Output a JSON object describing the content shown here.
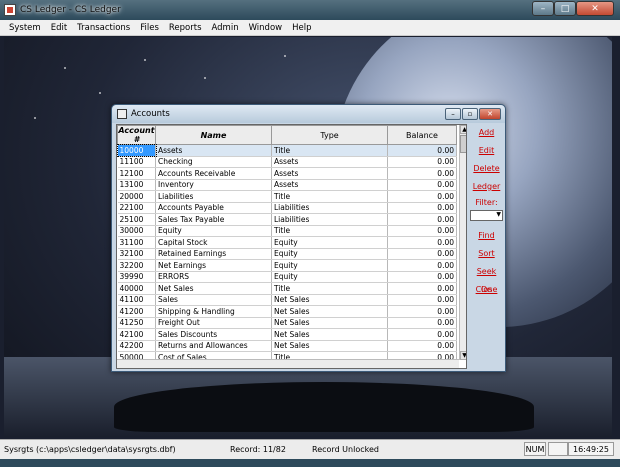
{
  "app": {
    "title": "CS Ledger - CS Ledger"
  },
  "menu": [
    "System",
    "Edit",
    "Transactions",
    "Files",
    "Reports",
    "Admin",
    "Window",
    "Help"
  ],
  "accounts_window": {
    "title": "Accounts",
    "columns": [
      "Account #",
      "Name",
      "Type",
      "Balance"
    ],
    "rows": [
      {
        "acct": "10000",
        "name": "Assets",
        "type": "Title",
        "balance": "0.00",
        "selected": true
      },
      {
        "acct": "11100",
        "name": "Checking",
        "type": "Assets",
        "balance": "0.00"
      },
      {
        "acct": "12100",
        "name": "Accounts Receivable",
        "type": "Assets",
        "balance": "0.00"
      },
      {
        "acct": "13100",
        "name": "Inventory",
        "type": "Assets",
        "balance": "0.00"
      },
      {
        "acct": "20000",
        "name": "Liabilities",
        "type": "Title",
        "balance": "0.00"
      },
      {
        "acct": "22100",
        "name": "Accounts Payable",
        "type": "Liabilities",
        "balance": "0.00"
      },
      {
        "acct": "25100",
        "name": "Sales Tax Payable",
        "type": "Liabilities",
        "balance": "0.00"
      },
      {
        "acct": "30000",
        "name": "Equity",
        "type": "Title",
        "balance": "0.00"
      },
      {
        "acct": "31100",
        "name": "Capital Stock",
        "type": "Equity",
        "balance": "0.00"
      },
      {
        "acct": "32100",
        "name": "Retained Earnings",
        "type": "Equity",
        "balance": "0.00"
      },
      {
        "acct": "32200",
        "name": "Net Earnings",
        "type": "Equity",
        "balance": "0.00"
      },
      {
        "acct": "39990",
        "name": "ERRORS",
        "type": "Equity",
        "balance": "0.00"
      },
      {
        "acct": "40000",
        "name": "Net Sales",
        "type": "Title",
        "balance": "0.00"
      },
      {
        "acct": "41100",
        "name": "Sales",
        "type": "Net Sales",
        "balance": "0.00"
      },
      {
        "acct": "41200",
        "name": "Shipping & Handling",
        "type": "Net Sales",
        "balance": "0.00"
      },
      {
        "acct": "41250",
        "name": "Freight Out",
        "type": "Net Sales",
        "balance": "0.00"
      },
      {
        "acct": "42100",
        "name": "Sales Discounts",
        "type": "Net Sales",
        "balance": "0.00"
      },
      {
        "acct": "42200",
        "name": "Returns and Allowances",
        "type": "Net Sales",
        "balance": "0.00"
      },
      {
        "acct": "50000",
        "name": "Cost of Sales",
        "type": "Title",
        "balance": "0.00"
      }
    ],
    "buttons": {
      "add": "Add",
      "edit": "Edit",
      "delete": "Delete",
      "ledger": "Ledger",
      "filter_label": "Filter:",
      "find": "Find",
      "sort": "Sort",
      "seek_on": "Seek On",
      "close": "Close"
    }
  },
  "status": {
    "path": "Sysrgts (c:\\apps\\csledger\\data\\sysrgts.dbf)",
    "record": "Record: 11/82",
    "lock": "Record Unlocked",
    "num": "NUM",
    "time": "16:49:25"
  },
  "colors": {
    "selection": "#3399ff",
    "action_text": "#cc0000"
  }
}
